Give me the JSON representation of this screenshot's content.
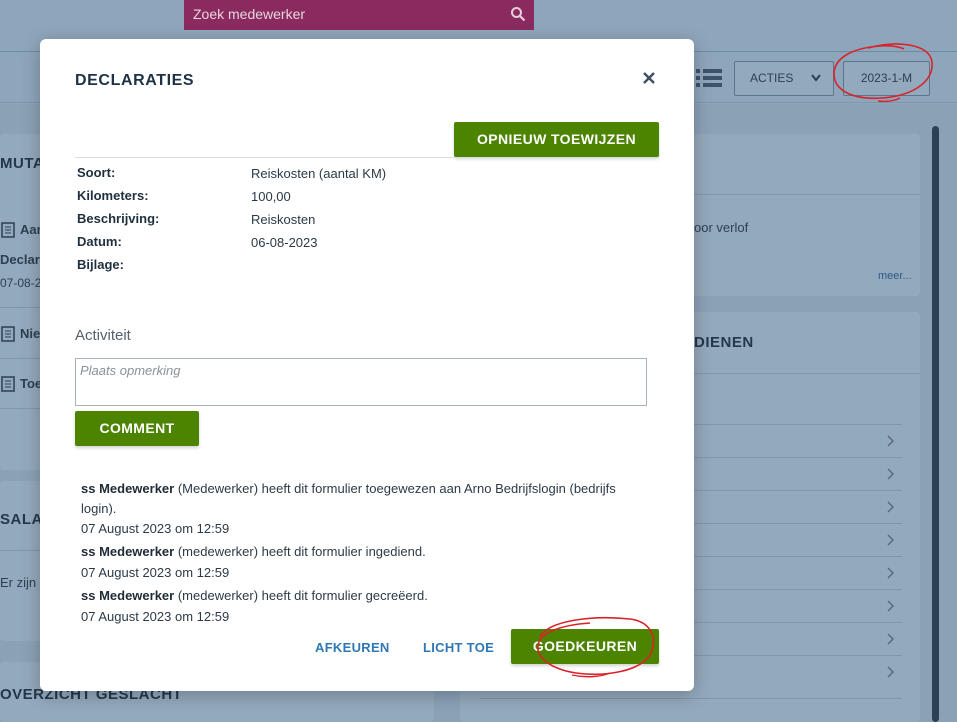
{
  "header": {
    "search_placeholder": "Zoek medewerker",
    "acties_label": "ACTIES",
    "period_label": "2023-1-M"
  },
  "background": {
    "left_cut_1": "MUTAT",
    "left_item_1": "Aan",
    "left_item_2": "Declara",
    "left_item_3": "07-08-2",
    "left_item_4": "Nie",
    "left_item_5": "Toe",
    "left_cut_2": "SALAF",
    "left_item_6": "Er zijn g",
    "left_cut_3": "OVERZICHT GESLACHT",
    "right_text_1": "oor verlof",
    "right_more": "meer...",
    "right_head_2": "DIENEN"
  },
  "modal": {
    "title": "DECLARATIES",
    "reassign_label": "OPNIEUW TOEWIJZEN",
    "fields": [
      {
        "label": "Soort:",
        "value": "Reiskosten (aantal KM)"
      },
      {
        "label": "Kilometers:",
        "value": "100,00"
      },
      {
        "label": "Beschrijving:",
        "value": "Reiskosten"
      },
      {
        "label": "Datum:",
        "value": "06-08-2023"
      },
      {
        "label": "Bijlage:",
        "value": ""
      }
    ],
    "activity_label": "Activiteit",
    "comment_placeholder": "Plaats opmerking",
    "comment_button": "COMMENT",
    "log": [
      {
        "actor": "ss Medewerker",
        "text": " (Medewerker) heeft dit formulier toegewezen aan Arno Bedrijfslogin (bedrijfs login).",
        "time": "07 August 2023 om 12:59"
      },
      {
        "actor": "ss Medewerker",
        "text": " (medewerker) heeft dit formulier ingediend.",
        "time": "07 August 2023 om 12:59"
      },
      {
        "actor": "ss Medewerker",
        "text": " (medewerker) heeft dit formulier gecreëerd.",
        "time": "07 August 2023 om 12:59"
      }
    ],
    "reject_label": "AFKEUREN",
    "explain_label": "LICHT TOE",
    "approve_label": "GOEDKEUREN"
  },
  "colors": {
    "accent_green": "#4c8400",
    "search_bg": "#8a2a5f",
    "link_blue": "#2e78b5",
    "annotation_red": "#d9232b"
  }
}
